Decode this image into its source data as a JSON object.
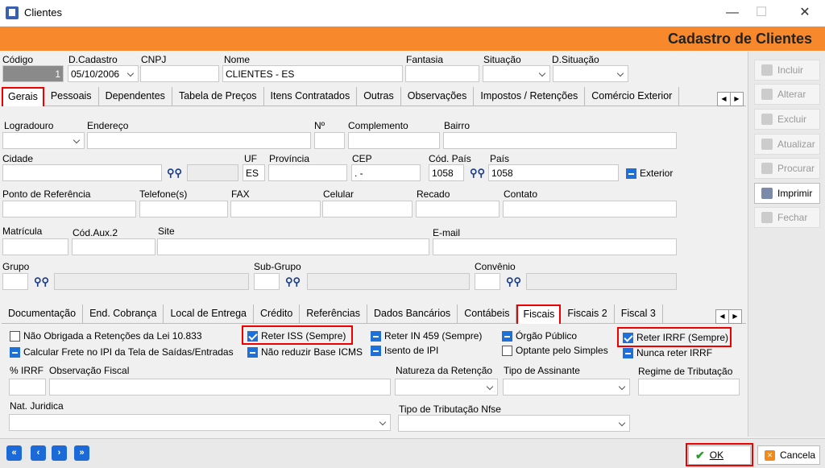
{
  "window": {
    "title": "Clientes",
    "min": "—",
    "max": "☐",
    "close": "✕"
  },
  "header": {
    "title": "Cadastro de Clientes"
  },
  "top_fields": {
    "codigo_label": "Código",
    "codigo_value": "1",
    "dcadastro_label": "D.Cadastro",
    "dcadastro_value": "05/10/2006",
    "cnpj_label": "CNPJ",
    "nome_label": "Nome",
    "nome_value": "CLIENTES - ES",
    "fantasia_label": "Fantasia",
    "situacao_label": "Situação",
    "dsituacao_label": "D.Situação"
  },
  "main_tabs": [
    "Gerais",
    "Pessoais",
    "Dependentes",
    "Tabela de Preços",
    "Itens Contratados",
    "Outras",
    "Observações",
    "Impostos / Retenções",
    "Comércio Exterior"
  ],
  "address": {
    "logradouro": "Logradouro",
    "endereco": "Endereço",
    "numero": "Nº",
    "complemento": "Complemento",
    "bairro": "Bairro",
    "cidade": "Cidade",
    "uf": "UF",
    "uf_value": "ES",
    "provincia": "Província",
    "cep": "CEP",
    "cep_value": ". -",
    "cod_pais": "Cód. País",
    "cod_pais_value": "1058",
    "pais": "País",
    "pais_value": "1058",
    "exterior": "Exterior",
    "ponto_ref": "Ponto de Referência",
    "telefones": "Telefone(s)",
    "fax": "FAX",
    "celular": "Celular",
    "recado": "Recado",
    "contato": "Contato",
    "matricula": "Matrícula",
    "cod_aux2": "Cód.Aux.2",
    "site": "Site",
    "email": "E-mail",
    "grupo": "Grupo",
    "subgrupo": "Sub-Grupo",
    "convenio": "Convênio"
  },
  "sub_tabs": [
    "Documentação",
    "End. Cobrança",
    "Local de Entrega",
    "Crédito",
    "Referências",
    "Dados Bancários",
    "Contábeis",
    "Fiscais",
    "Fiscais 2",
    "Fiscal 3"
  ],
  "fiscais": {
    "nao_obrigada": "Não Obrigada a Retenções da Lei 10.833",
    "calcular_frete": "Calcular Frete no IPI da Tela de Saídas/Entradas",
    "reter_iss": "Reter ISS (Sempre)",
    "nao_reduzir": "Não reduzir Base ICMS",
    "reter_in": "Reter IN 459 (Sempre)",
    "isento_ipi": "Isento de IPI",
    "orgao_publico": "Órgão Público",
    "optante": "Optante pelo Simples",
    "reter_irrf": "Reter IRRF (Sempre)",
    "nunca_irrf": "Nunca reter IRRF",
    "pct_irrf": "% IRRF",
    "obs_fiscal": "Observação Fiscal",
    "natureza": "Natureza da Retenção",
    "tipo_assinante": "Tipo de Assinante",
    "regime": "Regime de Tributação",
    "nat_juridica": "Nat. Juridica",
    "tipo_nfse": "Tipo de Tributação Nfse"
  },
  "side_buttons": [
    "Incluir",
    "Alterar",
    "Excluir",
    "Atualizar",
    "Procurar",
    "Imprimir",
    "Fechar"
  ],
  "bottom": {
    "ok": "OK",
    "cancel": "Cancela"
  }
}
